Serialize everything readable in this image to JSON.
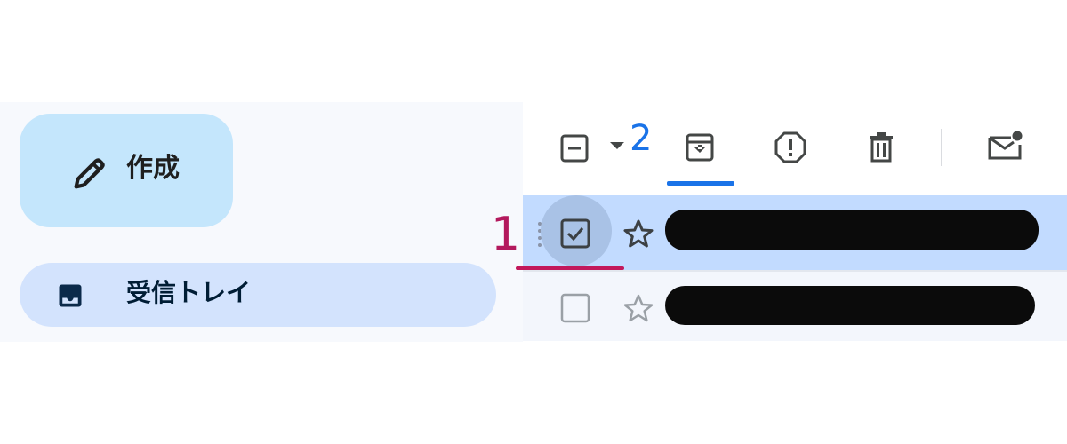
{
  "sidebar": {
    "compose_label": "作成",
    "items": [
      {
        "label": "受信トレイ",
        "icon": "inbox-icon",
        "active": true
      }
    ]
  },
  "toolbar": {
    "icons": [
      "select-partial-checkbox-icon",
      "select-dropdown-arrow-icon",
      "archive-icon",
      "report-spam-icon",
      "delete-icon",
      "mark-unread-icon"
    ]
  },
  "list": {
    "rows": [
      {
        "selected": true,
        "starred": false
      },
      {
        "selected": false,
        "starred": false
      }
    ]
  },
  "annotations": {
    "marker_1": "1",
    "marker_2": "2"
  },
  "colors": {
    "compose_bg": "#c4e6fc",
    "inbox_active_bg": "#d3e3fd",
    "selected_row_bg": "#c2dbff",
    "annotation_red": "#b3195d",
    "annotation_blue": "#1a73e8"
  }
}
